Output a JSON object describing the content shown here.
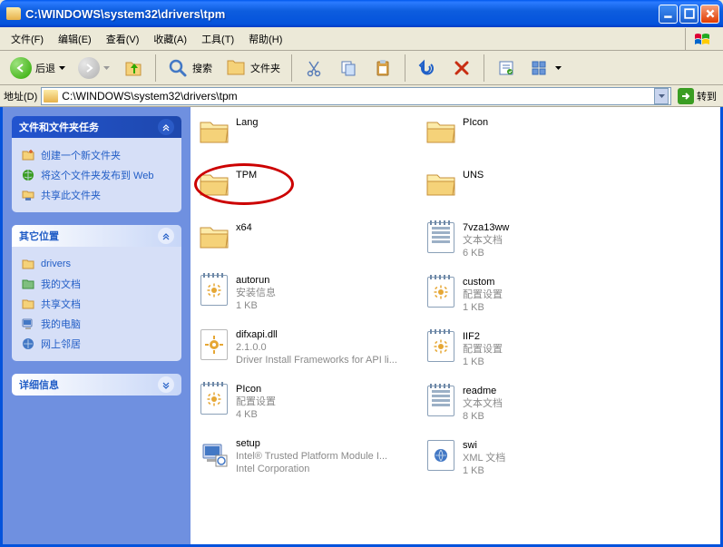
{
  "title": "C:\\WINDOWS\\system32\\drivers\\tpm",
  "menu": {
    "file": "文件(F)",
    "edit": "编辑(E)",
    "view": "查看(V)",
    "fav": "收藏(A)",
    "tools": "工具(T)",
    "help": "帮助(H)"
  },
  "toolbar": {
    "back": "后退",
    "search": "搜索",
    "folders": "文件夹"
  },
  "address": {
    "label": "地址(D)",
    "path": "C:\\WINDOWS\\system32\\drivers\\tpm",
    "go": "转到"
  },
  "sidebar": {
    "tasks": {
      "title": "文件和文件夹任务",
      "items": [
        "创建一个新文件夹",
        "将这个文件夹发布到 Web",
        "共享此文件夹"
      ]
    },
    "places": {
      "title": "其它位置",
      "items": [
        "drivers",
        "我的文档",
        "共享文档",
        "我的电脑",
        "网上邻居"
      ]
    },
    "details": {
      "title": "详细信息"
    }
  },
  "files": {
    "col1": [
      {
        "type": "folder",
        "name": "Lang"
      },
      {
        "type": "folder",
        "name": "TPM",
        "highlight": true
      },
      {
        "type": "folder",
        "name": "x64"
      },
      {
        "type": "ini",
        "name": "autorun",
        "sub1": "安装信息",
        "sub2": "1 KB"
      },
      {
        "type": "dll",
        "name": "difxapi.dll",
        "sub1": "2.1.0.0",
        "sub2": "Driver Install Frameworks for API li..."
      },
      {
        "type": "ini",
        "name": "PIcon",
        "sub1": "配置设置",
        "sub2": "4 KB"
      },
      {
        "type": "setup",
        "name": "setup",
        "sub1": "Intel® Trusted Platform Module I...",
        "sub2": "Intel Corporation"
      }
    ],
    "col2": [
      {
        "type": "folder",
        "name": "PIcon"
      },
      {
        "type": "folder",
        "name": "UNS"
      },
      {
        "type": "txt",
        "name": "7vza13ww",
        "sub1": "文本文档",
        "sub2": "6 KB"
      },
      {
        "type": "ini",
        "name": "custom",
        "sub1": "配置设置",
        "sub2": "1 KB"
      },
      {
        "type": "ini",
        "name": "IIF2",
        "sub1": "配置设置",
        "sub2": "1 KB"
      },
      {
        "type": "txt",
        "name": "readme",
        "sub1": "文本文档",
        "sub2": "8 KB"
      },
      {
        "type": "xml",
        "name": "swi",
        "sub1": "XML 文档",
        "sub2": "1 KB"
      }
    ]
  }
}
